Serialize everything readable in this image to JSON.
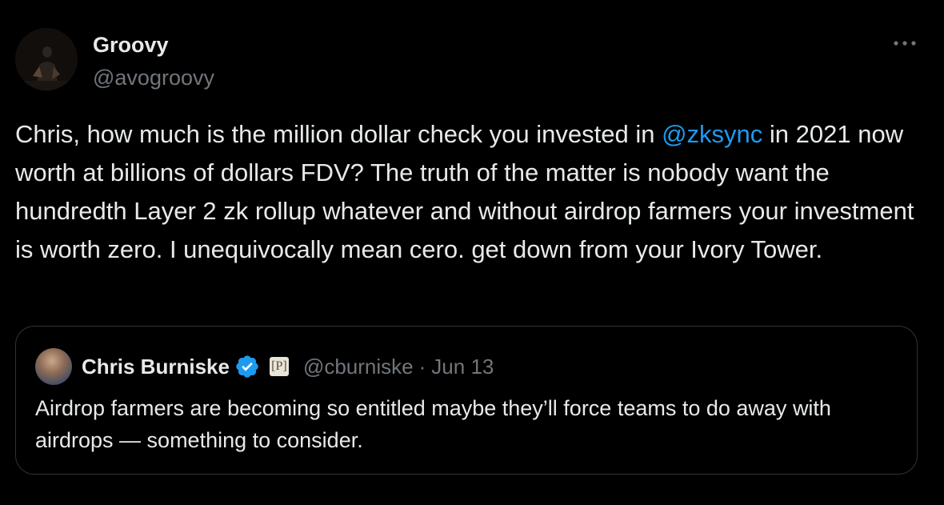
{
  "post": {
    "author_name": "Groovy",
    "author_handle": "@avogroovy",
    "text_before_mention": "Chris, how much is the million dollar check you invested in ",
    "mention": "@zksync",
    "text_after_mention": " in 2021 now worth at billions of dollars FDV? The truth of the matter is nobody want the hundredth Layer 2 zk rollup whatever and without airdrop farmers your investment is worth zero. I unequivocally mean cero. get down from your Ivory Tower.",
    "more_icon": "more-horizontal-icon"
  },
  "quote": {
    "author_name": "Chris Burniske",
    "verified_icon": "verified-badge-icon",
    "affiliate_badge_label": "[P]",
    "author_handle": "@cburniske",
    "separator": "·",
    "date": "Jun 13",
    "text": "Airdrop farmers are becoming so entitled maybe they’ll force teams to do away with airdrops — something to consider."
  },
  "colors": {
    "background": "#000000",
    "primary_text": "#e7e9ea",
    "secondary_text": "#71767b",
    "link": "#1d9bf0",
    "border": "#2f3336",
    "verified": "#1d9bf0"
  }
}
